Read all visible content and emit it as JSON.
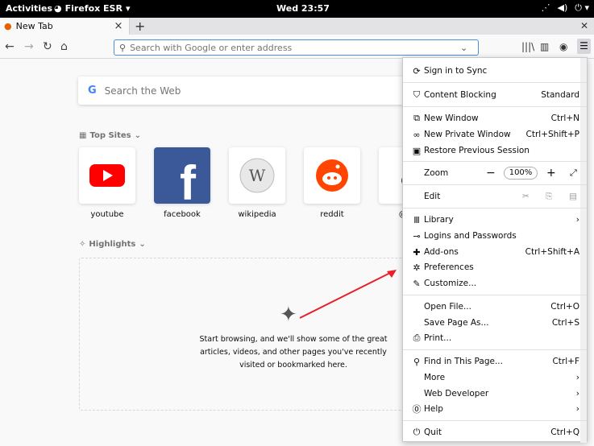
{
  "topbar": {
    "activities": "Activities",
    "app_name": "Firefox ESR",
    "clock": "Wed 23:57"
  },
  "tab": {
    "title": "New Tab",
    "close": "×"
  },
  "nav": {
    "url_placeholder": "Search with Google or enter address"
  },
  "newtab": {
    "search_placeholder": "Search the Web",
    "top_sites_label": "Top Sites",
    "highlights_label": "Highlights",
    "sites": [
      {
        "label": "youtube",
        "color": "#ff0000"
      },
      {
        "label": "facebook",
        "color": "#3b5998"
      },
      {
        "label": "wikipedia",
        "color": "#cccccc"
      },
      {
        "label": "reddit",
        "color": "#ff4500"
      },
      {
        "label": "@ar",
        "color": "#000000"
      }
    ],
    "highlights_message": "Start browsing, and we'll show some of the great articles, videos, and other pages you've recently visited or bookmarked here."
  },
  "menu": {
    "sign_in": "Sign in to Sync",
    "content_blocking": "Content Blocking",
    "content_blocking_value": "Standard",
    "new_window": "New Window",
    "new_window_sc": "Ctrl+N",
    "new_private": "New Private Window",
    "new_private_sc": "Ctrl+Shift+P",
    "restore": "Restore Previous Session",
    "zoom": "Zoom",
    "zoom_value": "100%",
    "edit": "Edit",
    "library": "Library",
    "logins": "Logins and Passwords",
    "addons": "Add-ons",
    "addons_sc": "Ctrl+Shift+A",
    "preferences": "Preferences",
    "customize": "Customize...",
    "open_file": "Open File...",
    "open_file_sc": "Ctrl+O",
    "save_page": "Save Page As...",
    "save_page_sc": "Ctrl+S",
    "print": "Print...",
    "find": "Find in This Page...",
    "find_sc": "Ctrl+F",
    "more": "More",
    "web_dev": "Web Developer",
    "help": "Help",
    "quit": "Quit",
    "quit_sc": "Ctrl+Q"
  },
  "annotation": {
    "arrow_color": "#e8202a"
  }
}
